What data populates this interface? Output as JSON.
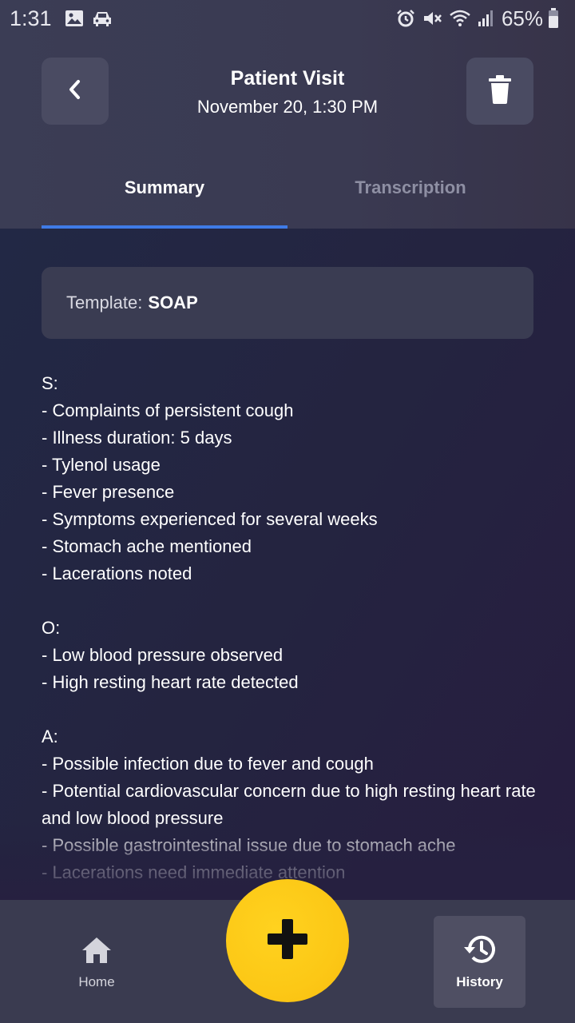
{
  "status_bar": {
    "time": "1:31",
    "battery_percent": "65%",
    "left_icons": [
      "gallery-icon",
      "car-icon"
    ],
    "right_icons": [
      "alarm-icon",
      "mute-icon",
      "wifi-icon",
      "signal-icon",
      "battery-icon"
    ]
  },
  "header": {
    "title": "Patient Visit",
    "subtitle": "November 20, 1:30 PM",
    "back_icon": "chevron-left-icon",
    "delete_icon": "trash-icon"
  },
  "tabs": [
    {
      "label": "Summary",
      "active": true
    },
    {
      "label": "Transcription",
      "active": false
    }
  ],
  "template": {
    "label": "Template:",
    "value": "SOAP"
  },
  "soap": {
    "s_heading": "S:",
    "s_items": [
      "- Complaints of persistent cough",
      "- Illness duration: 5 days",
      "- Tylenol usage",
      "- Fever presence",
      "- Symptoms experienced for several weeks",
      "- Stomach ache mentioned",
      "- Lacerations noted"
    ],
    "o_heading": "O:",
    "o_items": [
      "- Low blood pressure observed",
      "- High resting heart rate detected"
    ],
    "a_heading": "A:",
    "a_items": [
      "- Possible infection due to fever and cough",
      "- Potential cardiovascular concern due to high resting heart rate and low blood pressure",
      "- Possible gastrointestinal issue due to stomach ache",
      "- Lacerations need immediate attention"
    ]
  },
  "bottom_nav": {
    "home_label": "Home",
    "history_label": "History"
  },
  "colors": {
    "accent_blue": "#3f7be6",
    "fab_yellow": "#fcc816",
    "header_bg": "#3a3a52",
    "content_bg": "#242440",
    "card_bg": "#3a3c52"
  }
}
